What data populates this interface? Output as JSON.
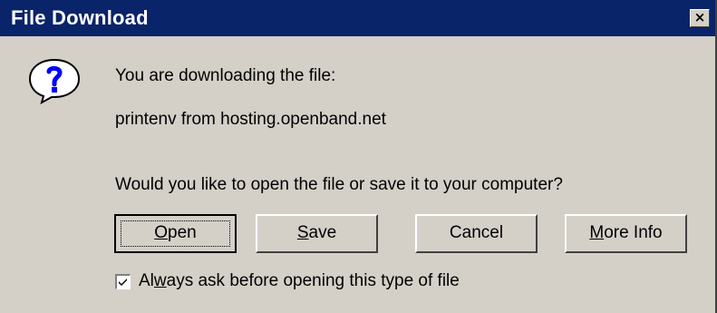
{
  "window": {
    "title": "File Download",
    "close_label": "×"
  },
  "message": {
    "line1": "You are downloading the file:",
    "line2": "printenv from hosting.openband.net",
    "line3": "Would you like to open the file or save it to your computer?"
  },
  "buttons": {
    "open": {
      "pre": "",
      "key": "O",
      "post": "pen"
    },
    "save": {
      "pre": "",
      "key": "S",
      "post": "ave"
    },
    "cancel": {
      "label": "Cancel"
    },
    "more_info": {
      "pre": "",
      "key": "M",
      "post": "ore Info"
    }
  },
  "checkbox": {
    "checked": true,
    "label_pre": "Al",
    "label_key": "w",
    "label_post": "ays ask before opening this type of file"
  },
  "icons": {
    "question": "question-icon"
  },
  "colors": {
    "titlebar": "#0a246a",
    "dialog_bg": "#d4d0c8",
    "icon_blue": "#0000ff"
  }
}
